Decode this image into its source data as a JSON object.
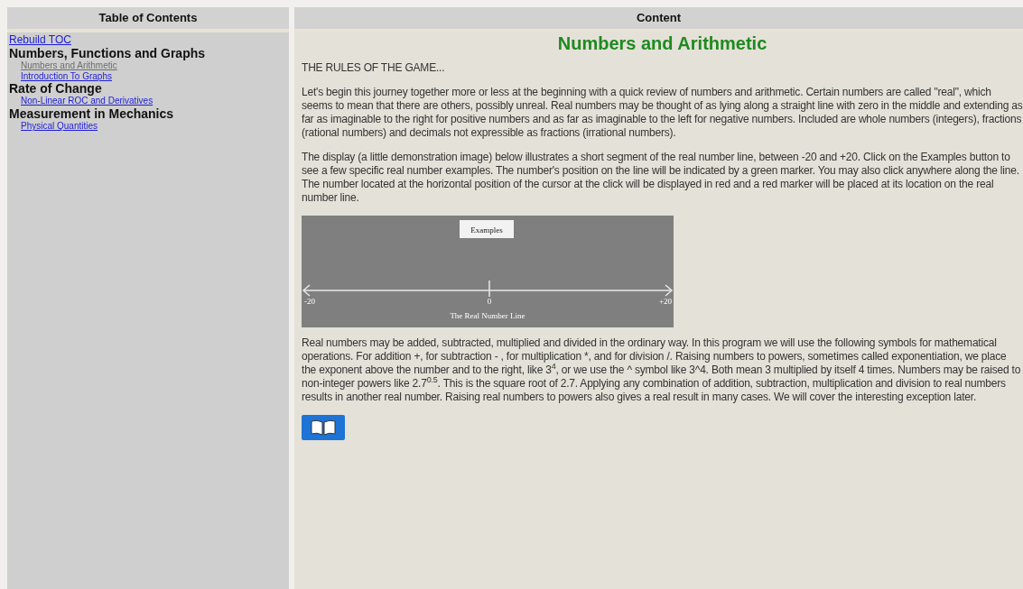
{
  "toc": {
    "header": "Table of Contents",
    "rebuild_link": "Rebuild TOC",
    "sections": [
      {
        "title": "Numbers, Functions and Graphs",
        "children": [
          {
            "label": "Numbers and Arithmetic",
            "selected": true
          },
          {
            "label": "Introduction To Graphs",
            "selected": false
          }
        ]
      },
      {
        "title": "Rate of Change",
        "children": [
          {
            "label": "Non-Linear ROC and Derivatives",
            "selected": false
          }
        ]
      },
      {
        "title": "Measurement in Mechanics",
        "children": [
          {
            "label": "Physical Quantities",
            "selected": false
          }
        ]
      }
    ]
  },
  "content": {
    "header": "Content",
    "title": "Numbers and Arithmetic",
    "paragraphs_before": [
      "THE RULES OF THE GAME...",
      "Let's begin this journey together more or less at the beginning with a quick review of numbers and arithmetic. Certain numbers are called \"real\", which seems to mean that there are others, possibly unreal. Real numbers may be thought of as lying along a straight line with zero in the middle and extending as far as imaginable to the right for positive numbers and as far as imaginable to the left for negative numbers. Included are whole numbers (integers), fractions (rational numbers) and decimals not expressible as fractions (irrational numbers).",
      "The display (a little demonstration image) below illustrates a short segment of the real number line, between -20 and +20. Click on the Examples button to see a few specific real number examples. The number's position on the line will be indicated by a green marker. You may also click anywhere along the line. The number located at the horizontal position of the cursor at the click will be displayed in red and a red marker will be placed at its location on the real number line."
    ],
    "demo": {
      "button": "Examples",
      "min_label": "-20",
      "zero_label": "0",
      "max_label": "+20",
      "caption": "The Real Number Line"
    },
    "paragraphs_after": [
      "Real numbers may be added, subtracted, multiplied and divided in the ordinary way. In this program we will use the following symbols for mathematical operations. For addition +, for subtraction - , for multiplication *, and for division /. Raising numbers to powers, sometimes called exponentiation, we place the exponent above the number and to the right, like 3$^{4}$, or we use the ^ symbol like 3^4. Both mean 3 multiplied by itself 4 times. Numbers may be raised to non-integer powers like 2.7$^{0.5}$. This is the square root of 2.7. Applying any combination of addition, subtraction, multiplication and division to real numbers results in another real number. Raising real numbers to powers also gives a real result in many cases. We will cover the interesting exception later."
    ]
  }
}
